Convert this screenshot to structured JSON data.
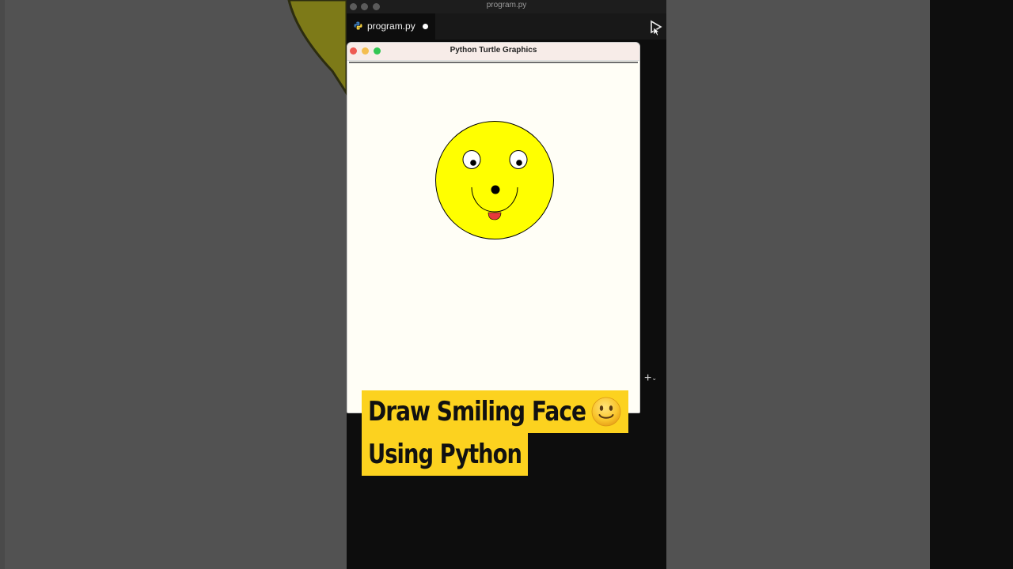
{
  "editor": {
    "window_title": "program.py",
    "tab": {
      "filename": "program.py",
      "unsaved": true
    }
  },
  "turtle_window": {
    "title": "Python Turtle Graphics",
    "traffic_lights": {
      "close": "#ee5a52",
      "minimize": "#f4be4f",
      "maximize": "#31c653"
    }
  },
  "drawing": {
    "face_color": "#ffff00",
    "outline_color": "#000000",
    "eye_white": "#ffffff",
    "pupil_color": "#000000",
    "tongue_color": "#e63b3b",
    "background": "#fffef6"
  },
  "caption": {
    "line1": "Draw Smiling Face",
    "line2": "Using Python",
    "emoji": "smiling-face",
    "bg_color": "#fcd21f"
  }
}
